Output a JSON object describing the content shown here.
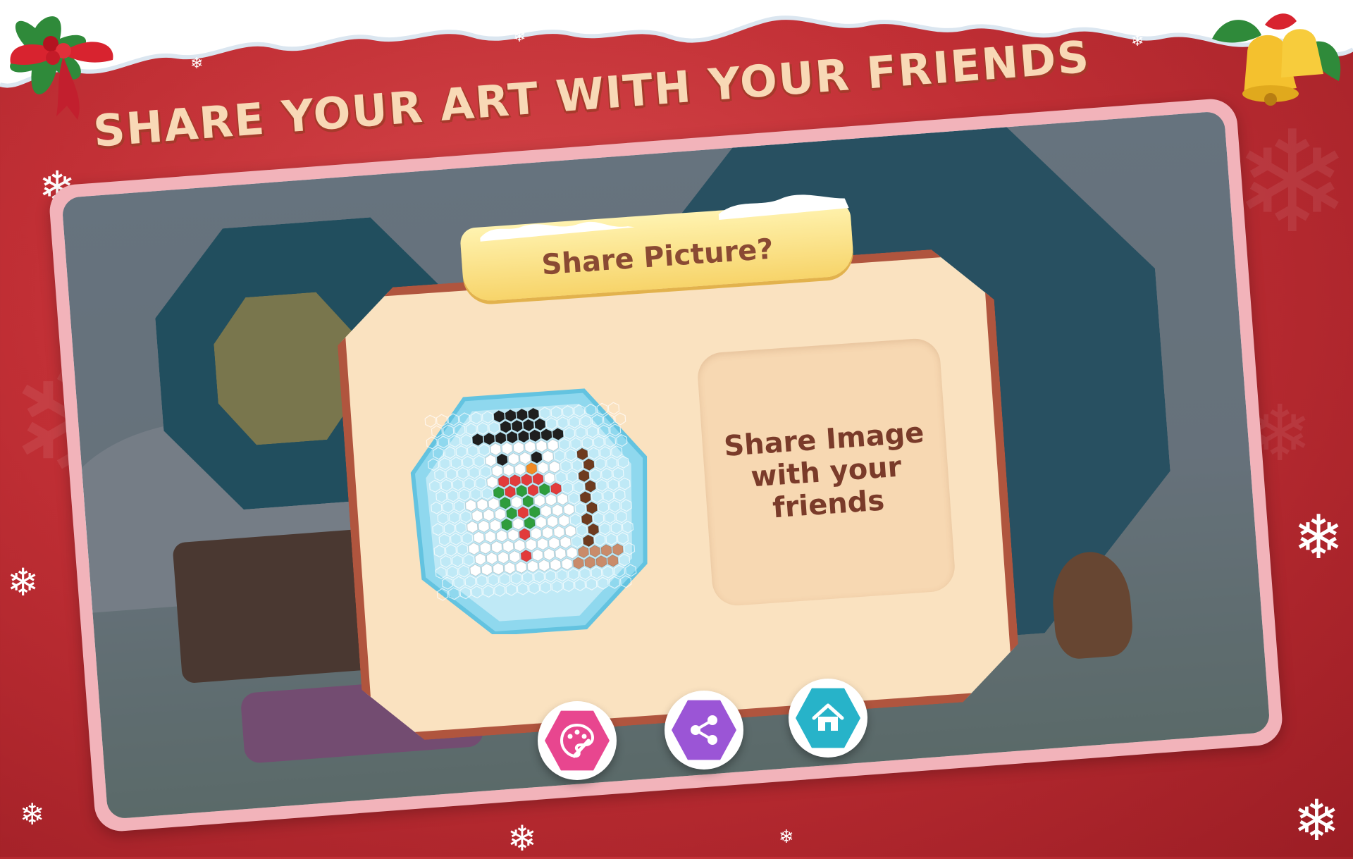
{
  "promo": {
    "headline": "SHARE YOUR ART WITH YOUR FRIENDS"
  },
  "dialog": {
    "title": "Share Picture?",
    "share_text": "Share Image\nwith your friends"
  },
  "buttons": [
    {
      "name": "paint-button",
      "icon": "palette-brush-icon",
      "color": "#e8468f"
    },
    {
      "name": "share-button",
      "icon": "share-icon",
      "color": "#9b55d6"
    },
    {
      "name": "home-button",
      "icon": "home-icon",
      "color": "#27b3c9"
    }
  ],
  "colors": {
    "background_red": "#c12f35",
    "frame_pink": "#f2b3ba",
    "card": "#fae2c0",
    "card_border": "#b0553e",
    "ribbon": "#f7d46a",
    "title_text": "#8a4a33",
    "headline_text": "#f8d9b6"
  },
  "bead_palette": [
    "#1f1f1f",
    "#ffffff",
    "#6e3b1f",
    "#d63aa0",
    "#2e9d3c",
    "#1fa7a8",
    "#c98b6a",
    "#e55ba5",
    "#f08a24",
    "#e23b3b"
  ]
}
